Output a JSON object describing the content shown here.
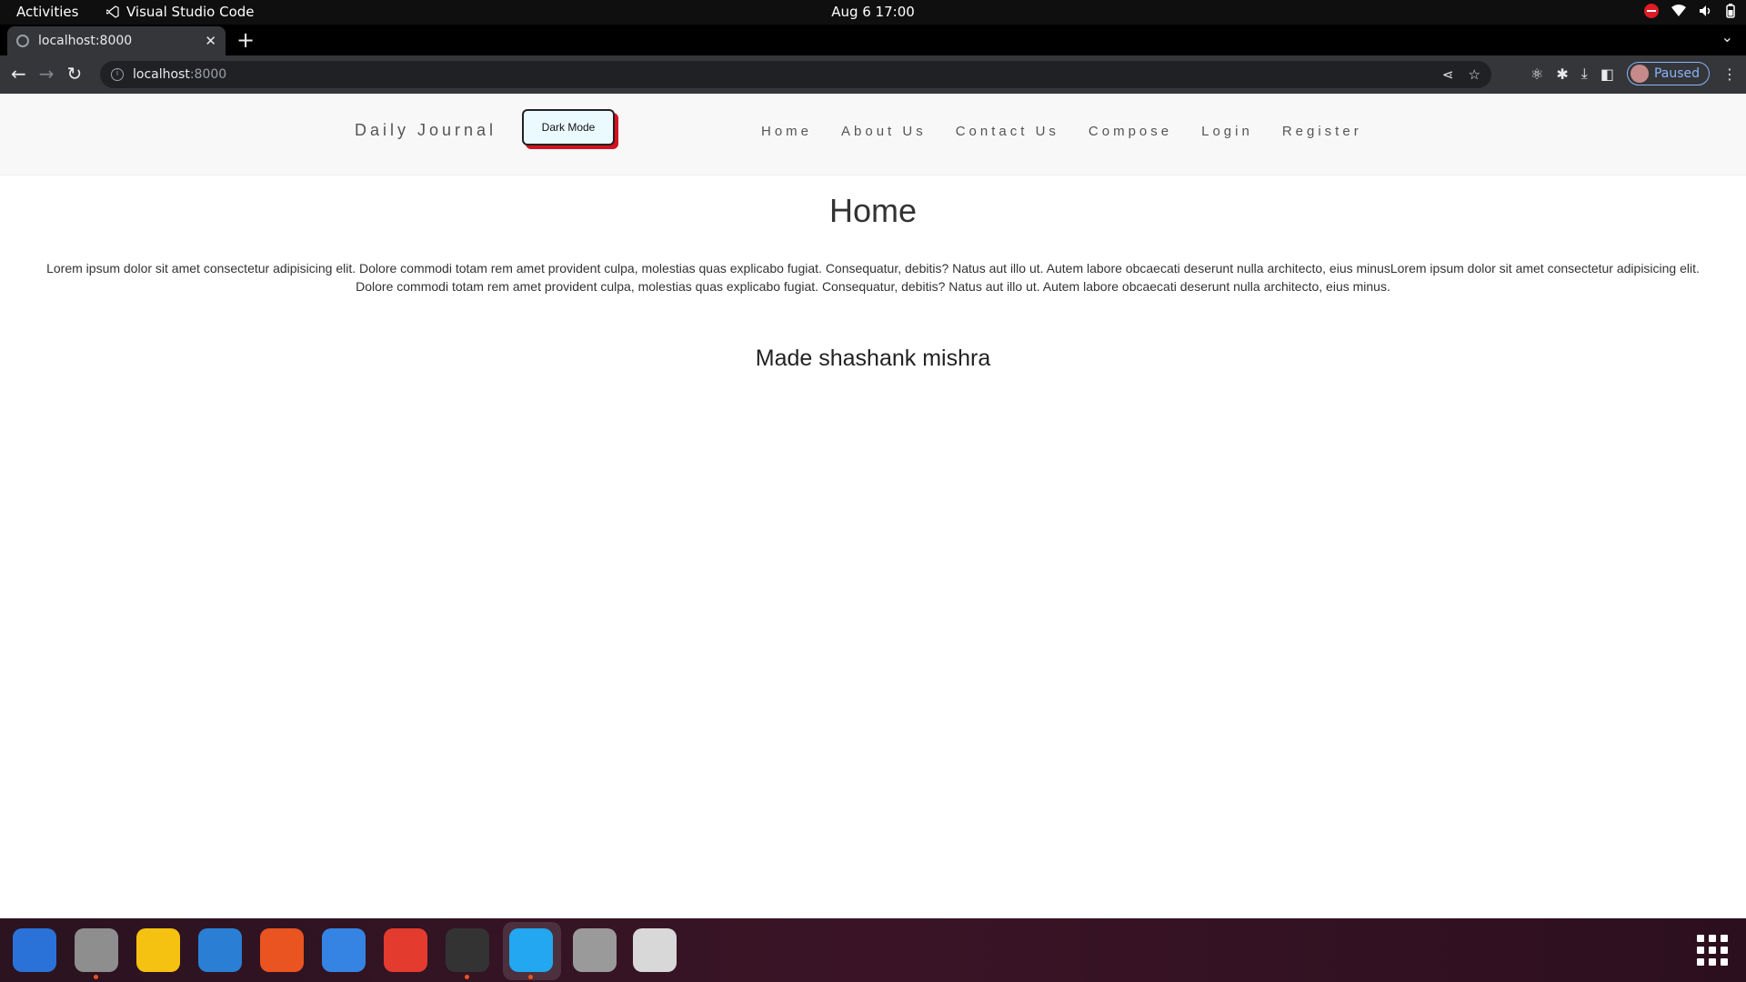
{
  "system_bar": {
    "activities": "Activities",
    "app_name": "Visual Studio Code",
    "clock": "Aug 6  17:00"
  },
  "browser": {
    "tab_title": "localhost:8000",
    "url_host": "localhost",
    "url_port": ":8000",
    "profile_label": "Paused"
  },
  "site": {
    "brand": "Daily Journal",
    "dark_mode_label": "Dark Mode",
    "nav": [
      "Home",
      "About Us",
      "Contact Us",
      "Compose",
      "Login",
      "Register"
    ],
    "page_title": "Home",
    "body_text": "Lorem ipsum dolor sit amet consectetur adipisicing elit. Dolore commodi totam rem amet provident culpa, molestias quas explicabo fugiat. Consequatur, debitis? Natus aut illo ut. Autem labore obcaecati deserunt nulla architecto, eius minusLorem ipsum dolor sit amet consectetur adipisicing elit. Dolore commodi totam rem amet provident culpa, molestias quas explicabo fugiat. Consequatur, debitis? Natus aut illo ut. Autem labore obcaecati deserunt nulla architecto, eius minus.",
    "footer_text": "Made shashank mishra"
  },
  "dock": {
    "apps": [
      {
        "name": "thunderbird-icon",
        "color": "#2a72d8"
      },
      {
        "name": "files-icon",
        "color": "#8e8e8e"
      },
      {
        "name": "rhythmbox-icon",
        "color": "#f5c211"
      },
      {
        "name": "writer-icon",
        "color": "#2a7fd4"
      },
      {
        "name": "software-icon",
        "color": "#e95420"
      },
      {
        "name": "help-icon",
        "color": "#3584e4"
      },
      {
        "name": "chrome-icon",
        "color": "#e33b2e"
      },
      {
        "name": "terminal-icon",
        "color": "#333333"
      },
      {
        "name": "vscode-icon",
        "color": "#22a7f0"
      },
      {
        "name": "disk-icon",
        "color": "#9a9a9a"
      },
      {
        "name": "trash-icon",
        "color": "#d8d8d8"
      }
    ]
  }
}
